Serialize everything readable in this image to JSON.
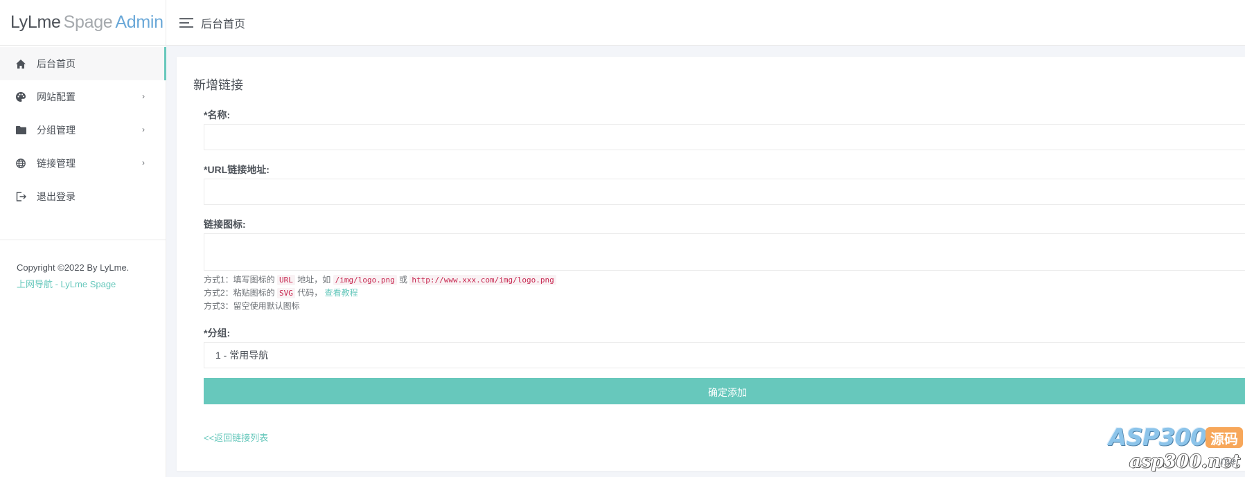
{
  "logo": {
    "part1": "LyLme",
    "part2": "Spage",
    "part3": "Admin"
  },
  "sidebar": {
    "items": [
      {
        "label": "后台首页",
        "icon": "home-icon",
        "active": true,
        "has_arrow": false
      },
      {
        "label": "网站配置",
        "icon": "palette-icon",
        "active": false,
        "has_arrow": true
      },
      {
        "label": "分组管理",
        "icon": "folder-icon",
        "active": false,
        "has_arrow": true
      },
      {
        "label": "链接管理",
        "icon": "globe-icon",
        "active": false,
        "has_arrow": true
      },
      {
        "label": "退出登录",
        "icon": "logout-icon",
        "active": false,
        "has_arrow": false
      }
    ],
    "arrow": "›",
    "copyright": "Copyright ©2022 By LyLme.",
    "copyright_link": "上网导航 - LyLme Spage"
  },
  "header": {
    "title": "后台首页",
    "menu_icon": "hamburger-menu-icon"
  },
  "form": {
    "title": "新增链接",
    "name_label": "*名称:",
    "name_value": "",
    "url_label": "*URL链接地址:",
    "url_value": "",
    "icon_label": "链接图标:",
    "icon_value": "",
    "hint1": {
      "prefix": "方式1：填写图标的",
      "code1": "URL",
      "mid": "地址，如",
      "code2": "/img/logo.png",
      "or": "或",
      "code3": "http://www.xxx.com/img/logo.png"
    },
    "hint2": {
      "prefix": "方式2：粘贴图标的",
      "code1": "SVG",
      "mid": "代码，",
      "link": "查看教程"
    },
    "hint3": "方式3：留空使用默认图标",
    "group_label": "*分组:",
    "group_selected": "1 - 常用导航",
    "submit_label": "确定添加",
    "back_link": "<<返回链接列表"
  },
  "watermark": {
    "top": "ASP300",
    "badge": "源码",
    "bottom": "asp300.net",
    "tail": "me"
  },
  "colors": {
    "accent": "#67c8bc",
    "logo_admin": "#6aa8d8",
    "background": "#f3f5f9"
  }
}
